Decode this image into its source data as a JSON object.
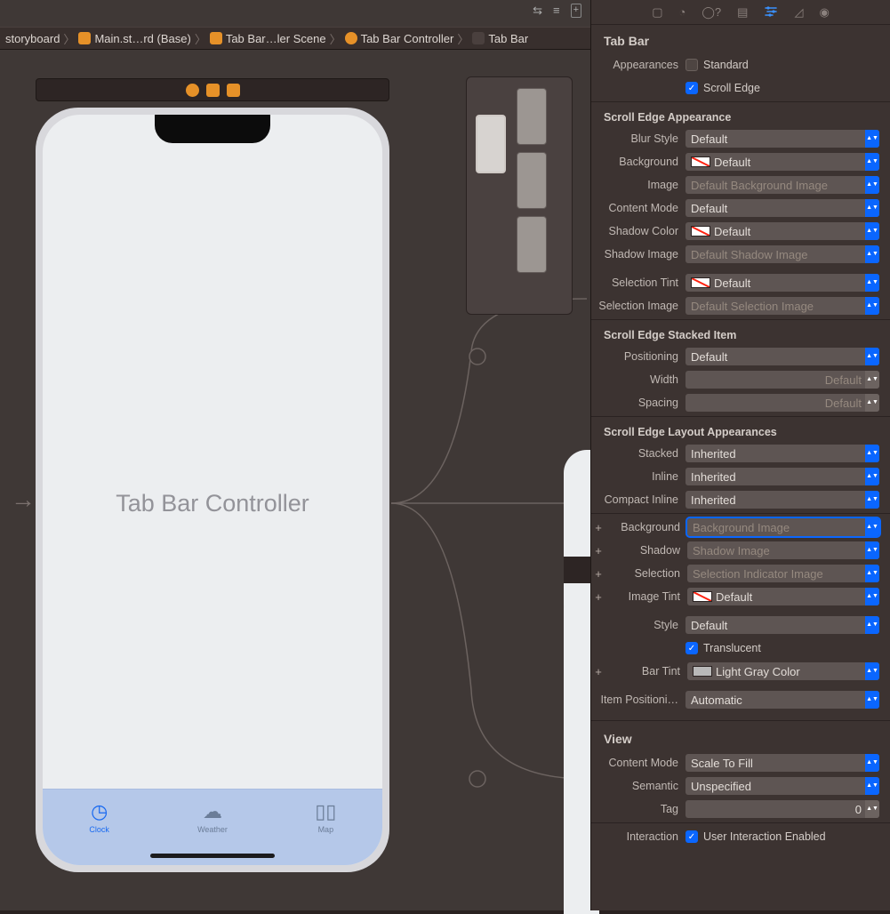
{
  "toolbar": {
    "icons": [
      "recents-icon",
      "lines-icon",
      "add-icon"
    ]
  },
  "breadcrumb": {
    "items": [
      {
        "label": "storyboard"
      },
      {
        "label": "Main.st…rd (Base)"
      },
      {
        "label": "Tab Bar…ler Scene"
      },
      {
        "label": "Tab Bar Controller"
      },
      {
        "label": "Tab Bar"
      }
    ]
  },
  "canvas": {
    "title_label": "Tab Bar Controller",
    "tabs": [
      {
        "icon": "clock",
        "label": "Clock",
        "active": true
      },
      {
        "icon": "cloud",
        "label": "Weather",
        "active": false
      },
      {
        "icon": "map",
        "label": "Map",
        "active": false
      }
    ]
  },
  "inspector": {
    "heading": "Tab Bar",
    "appearances": {
      "label": "Appearances",
      "standard": "Standard",
      "standard_on": false,
      "scroll": "Scroll Edge",
      "scroll_on": true
    },
    "grp_scrollEdge": "Scroll Edge Appearance",
    "blur_style": {
      "label": "Blur Style",
      "value": "Default"
    },
    "background": {
      "label": "Background",
      "value": "Default",
      "swatch": "none"
    },
    "image": {
      "label": "Image",
      "value": "Default Background Image",
      "placeholder": true
    },
    "content_mode": {
      "label": "Content Mode",
      "value": "Default"
    },
    "shadow_color": {
      "label": "Shadow Color",
      "value": "Default",
      "swatch": "none"
    },
    "shadow_image": {
      "label": "Shadow Image",
      "value": "Default Shadow Image",
      "placeholder": true
    },
    "selection_tint": {
      "label": "Selection Tint",
      "value": "Default",
      "swatch": "none"
    },
    "selection_image": {
      "label": "Selection Image",
      "value": "Default Selection Image",
      "placeholder": true
    },
    "grp_stacked": "Scroll Edge Stacked Item",
    "positioning": {
      "label": "Positioning",
      "value": "Default"
    },
    "width": {
      "label": "Width",
      "value": "Default"
    },
    "spacing": {
      "label": "Spacing",
      "value": "Default"
    },
    "grp_layout": "Scroll Edge Layout Appearances",
    "stacked": {
      "label": "Stacked",
      "value": "Inherited"
    },
    "inline": {
      "label": "Inline",
      "value": "Inherited"
    },
    "compact": {
      "label": "Compact Inline",
      "value": "Inherited"
    },
    "bg2": {
      "label": "Background",
      "value": "Background Image",
      "placeholder": true,
      "selected": true
    },
    "shadow2": {
      "label": "Shadow",
      "value": "Shadow Image",
      "placeholder": true
    },
    "selection2": {
      "label": "Selection",
      "value": "Selection Indicator Image",
      "placeholder": true
    },
    "imagetint": {
      "label": "Image Tint",
      "value": "Default",
      "swatch": "none"
    },
    "style": {
      "label": "Style",
      "value": "Default"
    },
    "translucent": {
      "label": "Translucent",
      "on": true
    },
    "bartint": {
      "label": "Bar Tint",
      "value": "Light Gray Color",
      "swatch": "lg"
    },
    "item_pos": {
      "label": "Item Positioni…",
      "value": "Automatic"
    },
    "view": "View",
    "view_content": {
      "label": "Content Mode",
      "value": "Scale To Fill"
    },
    "semantic": {
      "label": "Semantic",
      "value": "Unspecified"
    },
    "tag": {
      "label": "Tag",
      "value": "0"
    },
    "interaction": {
      "label": "Interaction",
      "text": "User Interaction Enabled",
      "on": true
    }
  }
}
